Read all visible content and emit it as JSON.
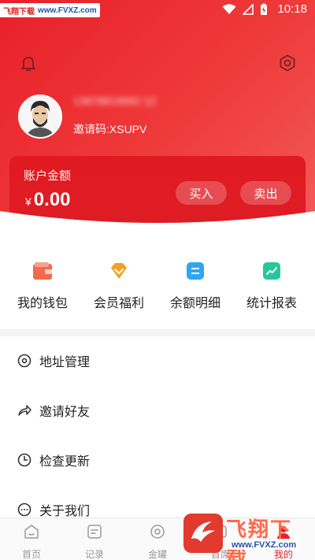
{
  "status_bar": {
    "watermark_left": "飞翔下载",
    "watermark_url": "www.FVXZ.com",
    "time": "10:18"
  },
  "header": {
    "phone_masked": "13878819992 12",
    "invite_code": "邀请码:XSUPV"
  },
  "balance": {
    "label": "账户金额",
    "currency": "¥",
    "amount": "0.00",
    "buy_label": "买入",
    "sell_label": "卖出"
  },
  "features": [
    {
      "label": "我的钱包",
      "icon": "wallet-icon",
      "color": "#f26a4e"
    },
    {
      "label": "会员福利",
      "icon": "diamond-icon",
      "color": "#f5a020"
    },
    {
      "label": "余额明细",
      "icon": "detail-icon",
      "color": "#2ea6f2"
    },
    {
      "label": "统计报表",
      "icon": "chart-icon",
      "color": "#27c79a"
    }
  ],
  "menu": [
    {
      "label": "地址管理",
      "icon": "location-icon"
    },
    {
      "label": "邀请好友",
      "icon": "share-icon"
    },
    {
      "label": "检查更新",
      "icon": "clock-icon"
    },
    {
      "label": "关于我们",
      "icon": "chat-icon"
    }
  ],
  "tabs": [
    {
      "label": "首页",
      "icon": "home-icon"
    },
    {
      "label": "记录",
      "icon": "record-icon"
    },
    {
      "label": "金罐",
      "icon": "jar-icon"
    },
    {
      "label": "首席",
      "icon": "chief-icon"
    },
    {
      "label": "我的",
      "icon": "profile-icon",
      "active": true
    }
  ],
  "watermark_bottom": {
    "brand": "飞翔下载",
    "url": "www.FVXZ.com"
  },
  "colors": {
    "primary": "#e8202a",
    "active_tab": "#e8202a"
  }
}
